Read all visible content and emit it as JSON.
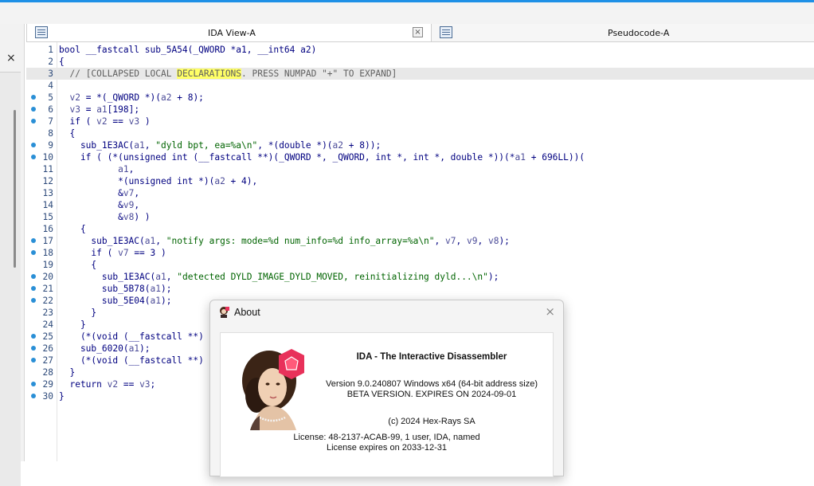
{
  "tabs": {
    "left_close": "×",
    "ida_view": "IDA View-A",
    "ida_close": "×",
    "pseudocode": "Pseudocode-A"
  },
  "code_lines": [
    {
      "n": "1",
      "dot": false,
      "html": "bool __fastcall sub_5A54(_QWORD *a1, __int64 a2)"
    },
    {
      "n": "2",
      "dot": false,
      "html": "{"
    },
    {
      "n": "3",
      "dot": false,
      "hl": true,
      "html": "  <span class='cm'>// [COLLAPSED LOCAL <span class='yh'>DECLARATIONS</span>. PRESS NUMPAD \"+\" TO EXPAND]</span>"
    },
    {
      "n": "4",
      "dot": false,
      "html": ""
    },
    {
      "n": "5",
      "dot": true,
      "html": "  <span class='v'>v2</span> = *(_QWORD *)(<span class='v'>a2</span> + 8);"
    },
    {
      "n": "6",
      "dot": true,
      "html": "  <span class='v'>v3</span> = <span class='v'>a1</span>[198];"
    },
    {
      "n": "7",
      "dot": true,
      "html": "  if ( <span class='v'>v2</span> == <span class='v'>v3</span> )"
    },
    {
      "n": "8",
      "dot": false,
      "html": "  {"
    },
    {
      "n": "9",
      "dot": true,
      "html": "    sub_1E3AC(<span class='v'>a1</span>, <span class='str'>\"dyld bpt, ea=%a\\n\"</span>, *(double *)(<span class='v'>a2</span> + 8));"
    },
    {
      "n": "10",
      "dot": true,
      "html": "    if ( (*(unsigned int (__fastcall **)(_QWORD *, _QWORD, int *, int *, double *))(*<span class='v'>a1</span> + 696LL))("
    },
    {
      "n": "11",
      "dot": false,
      "html": "           <span class='v'>a1</span>,"
    },
    {
      "n": "12",
      "dot": false,
      "html": "           *(unsigned int *)(<span class='v'>a2</span> + 4),"
    },
    {
      "n": "13",
      "dot": false,
      "html": "           &amp;<span class='v'>v7</span>,"
    },
    {
      "n": "14",
      "dot": false,
      "html": "           &amp;<span class='v'>v9</span>,"
    },
    {
      "n": "15",
      "dot": false,
      "html": "           &amp;<span class='v'>v8</span>) )"
    },
    {
      "n": "16",
      "dot": false,
      "html": "    {"
    },
    {
      "n": "17",
      "dot": true,
      "html": "      sub_1E3AC(<span class='v'>a1</span>, <span class='str'>\"notify args: mode=%d num_info=%d info_array=%a\\n\"</span>, <span class='v'>v7</span>, <span class='v'>v9</span>, <span class='v'>v8</span>);"
    },
    {
      "n": "18",
      "dot": true,
      "html": "      if ( <span class='v'>v7</span> == 3 )"
    },
    {
      "n": "19",
      "dot": false,
      "html": "      {"
    },
    {
      "n": "20",
      "dot": true,
      "html": "        sub_1E3AC(<span class='v'>a1</span>, <span class='str'>\"detected DYLD_IMAGE_DYLD_MOVED, reinitializing dyld...\\n\"</span>);"
    },
    {
      "n": "21",
      "dot": true,
      "html": "        sub_5B78(<span class='v'>a1</span>);"
    },
    {
      "n": "22",
      "dot": true,
      "html": "        sub_5E04(<span class='v'>a1</span>);"
    },
    {
      "n": "23",
      "dot": false,
      "html": "      }"
    },
    {
      "n": "24",
      "dot": false,
      "html": "    }"
    },
    {
      "n": "25",
      "dot": true,
      "html": "    (*(void (__fastcall **)"
    },
    {
      "n": "26",
      "dot": true,
      "html": "    sub_6020(<span class='v'>a1</span>);"
    },
    {
      "n": "27",
      "dot": true,
      "html": "    (*(void (__fastcall **)"
    },
    {
      "n": "28",
      "dot": false,
      "html": "  }"
    },
    {
      "n": "29",
      "dot": true,
      "html": "  return <span class='v'>v2</span> == <span class='v'>v3</span>;"
    },
    {
      "n": "30",
      "dot": true,
      "html": "}"
    }
  ],
  "about": {
    "title": "About",
    "close": "×",
    "product": "IDA - The Interactive Disassembler",
    "version": "Version 9.0.240807 Windows x64 (64-bit address size)",
    "beta": "BETA VERSION. EXPIRES ON 2024-09-01",
    "copyright": "(c) 2024 Hex-Rays SA",
    "license": "License: 48-2137-ACAB-99, 1 user, IDA, named",
    "license_expiry": "License expires on 2033-12-31"
  },
  "colors": {
    "accent": "#1e90e6",
    "breakpoint_dot": "#2a8fd6",
    "logo_pink": "#e8315a"
  }
}
